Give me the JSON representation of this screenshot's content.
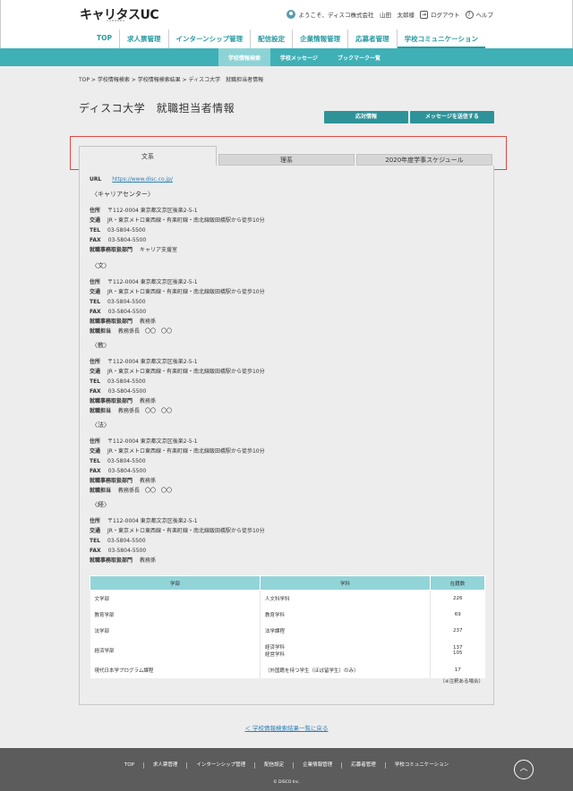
{
  "header": {
    "logo": "キャリタスUC",
    "logo_sub": "CAREERS",
    "greeting": "ようこそ、ディスコ株式会社　山田　太郎様",
    "logout": "ログアウト",
    "help": "ヘルプ"
  },
  "gnav": [
    "TOP",
    "求人票管理",
    "インターンシップ管理",
    "配信設定",
    "企業情報管理",
    "応募者管理",
    "学校コミュニケーション"
  ],
  "gnav_active": "学校コミュニケーション",
  "subnav": [
    "学校情報検索",
    "学校メッセージ",
    "ブックマーク一覧"
  ],
  "subnav_active": "学校情報検索",
  "breadcrumb": "TOP > 学校情報検索 > 学校情報検索結果 > ディスコ大学　就職担当者情報",
  "page_title": "ディスコ大学　就職担当者情報",
  "buttons": {
    "contact": "応対情報",
    "message": "メッセージを送信する"
  },
  "tabs": {
    "bunkei": "文系",
    "rikei": "理系",
    "schedule": "2020年度学事スケジュール"
  },
  "url": {
    "label": "URL",
    "value": "https://www.disc.co.jp/"
  },
  "labels": {
    "address": "住所",
    "transit": "交通",
    "tel": "TEL",
    "fax": "FAX",
    "office": "就職事務取扱部門",
    "person": "就職担当"
  },
  "sections": [
    {
      "head": "〈キャリアセンター〉",
      "address": "〒112-0004 東京都文京区後楽2-5-1",
      "transit": "JR・東京メトロ東西線・有楽町線・南北線飯田橋駅から徒歩10分",
      "tel": "03-5804-5500",
      "fax": "03-5804-5500",
      "office": "キャリア支援室"
    },
    {
      "head": "〈文〉",
      "address": "〒112-0004 東京都文京区後楽2-5-1",
      "transit": "JR・東京メトロ東西線・有楽町線・南北線飯田橋駅から徒歩10分",
      "tel": "03-5804-5500",
      "fax": "03-5804-5500",
      "office": "教務係",
      "person": "教務係長　〇〇　〇〇"
    },
    {
      "head": "〈教〉",
      "address": "〒112-0004 東京都文京区後楽2-5-1",
      "transit": "JR・東京メトロ東西線・有楽町線・南北線飯田橋駅から徒歩10分",
      "tel": "03-5804-5500",
      "fax": "03-5804-5500",
      "office": "教務係",
      "person": "教務係長　〇〇　〇〇"
    },
    {
      "head": "〈法〉",
      "address": "〒112-0004 東京都文京区後楽2-5-1",
      "transit": "JR・東京メトロ東西線・有楽町線・南北線飯田橋駅から徒歩10分",
      "tel": "03-5804-5500",
      "fax": "03-5804-5500",
      "office": "教務係",
      "person": "教務係長　〇〇　〇〇"
    },
    {
      "head": "〈経〉",
      "address": "〒112-0004 東京都文京区後楽2-5-1",
      "transit": "JR・東京メトロ東西線・有楽町線・南北線飯田橋駅から徒歩10分",
      "tel": "03-5804-5500",
      "fax": "03-5804-5500",
      "office": "教務係"
    }
  ],
  "table": {
    "headers": [
      "学部",
      "学科",
      "在籍数"
    ],
    "rows": [
      {
        "dept": "文学部",
        "subject": "人文科学科",
        "count": "226"
      },
      {
        "dept": "教育学部",
        "subject": "教育学科",
        "count": "69"
      },
      {
        "dept": "法学部",
        "subject": "法学課程",
        "count": "237"
      },
      {
        "dept": "経済学部",
        "subject": "経済学科",
        "count": "137",
        "subject2": "経営学科",
        "count2": "105"
      },
      {
        "dept": "現代日本学プログラム課程",
        "subject": "（外国籍を持つ学生（ほぼ留学生）のみ）",
        "count": "17"
      }
    ],
    "note": "（※注釈ある場合）"
  },
  "back_link": "＜ 学校情報検索結果一覧に戻る",
  "footer": {
    "nav": [
      "TOP",
      "求人票管理",
      "インターンシップ管理",
      "配信設定",
      "企業情報管理",
      "応募者管理",
      "学校コミュニケーション"
    ],
    "copyright": "© DISCO Inc.",
    "totop_icon": "chevron-up-icon"
  },
  "colors": {
    "accent": "#2a9aa1",
    "subnav": "#3fb0b6",
    "button": "#2e9399",
    "highlight": "#e04848"
  }
}
